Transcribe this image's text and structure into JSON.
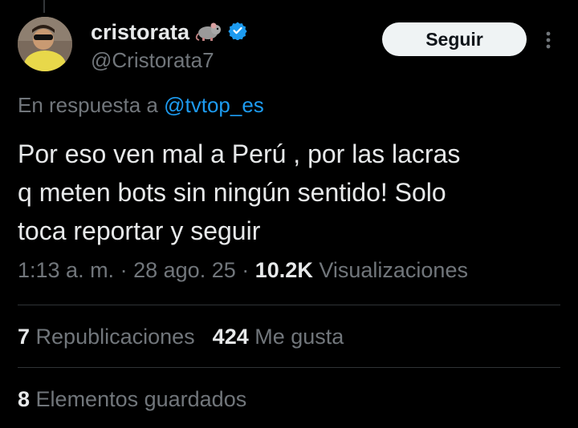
{
  "tweet": {
    "author": {
      "display_name": "cristorata",
      "handle": "@Cristorata7",
      "name_emoji": "rat-emoji",
      "verified": true
    },
    "follow_label": "Seguir",
    "reply_prefix": "En respuesta a",
    "reply_to": "@tvtop_es",
    "text_lines": [
      "Por eso ven mal a Perú , por las lacras",
      "q meten bots sin ningún sentido! Solo",
      "toca reportar y seguir"
    ],
    "time": "1:13 a. m.",
    "date": "28 ago. 25",
    "separator": "·",
    "views_count": "10.2K",
    "views_label": "Visualizaciones",
    "reposts_count": "7",
    "reposts_label": "Republicaciones",
    "likes_count": "424",
    "likes_label": "Me gusta",
    "bookmarks_count": "8",
    "bookmarks_label": "Elementos guardados"
  },
  "colors": {
    "background": "#000000",
    "text_primary": "#e7e9ea",
    "text_secondary": "#71767b",
    "link": "#1d9bf0",
    "verified": "#1d9bf0",
    "follow_bg": "#eff3f4",
    "divider": "#2f3336"
  },
  "icons": {
    "verified": "verified-badge-icon",
    "more": "more-dots-icon"
  }
}
